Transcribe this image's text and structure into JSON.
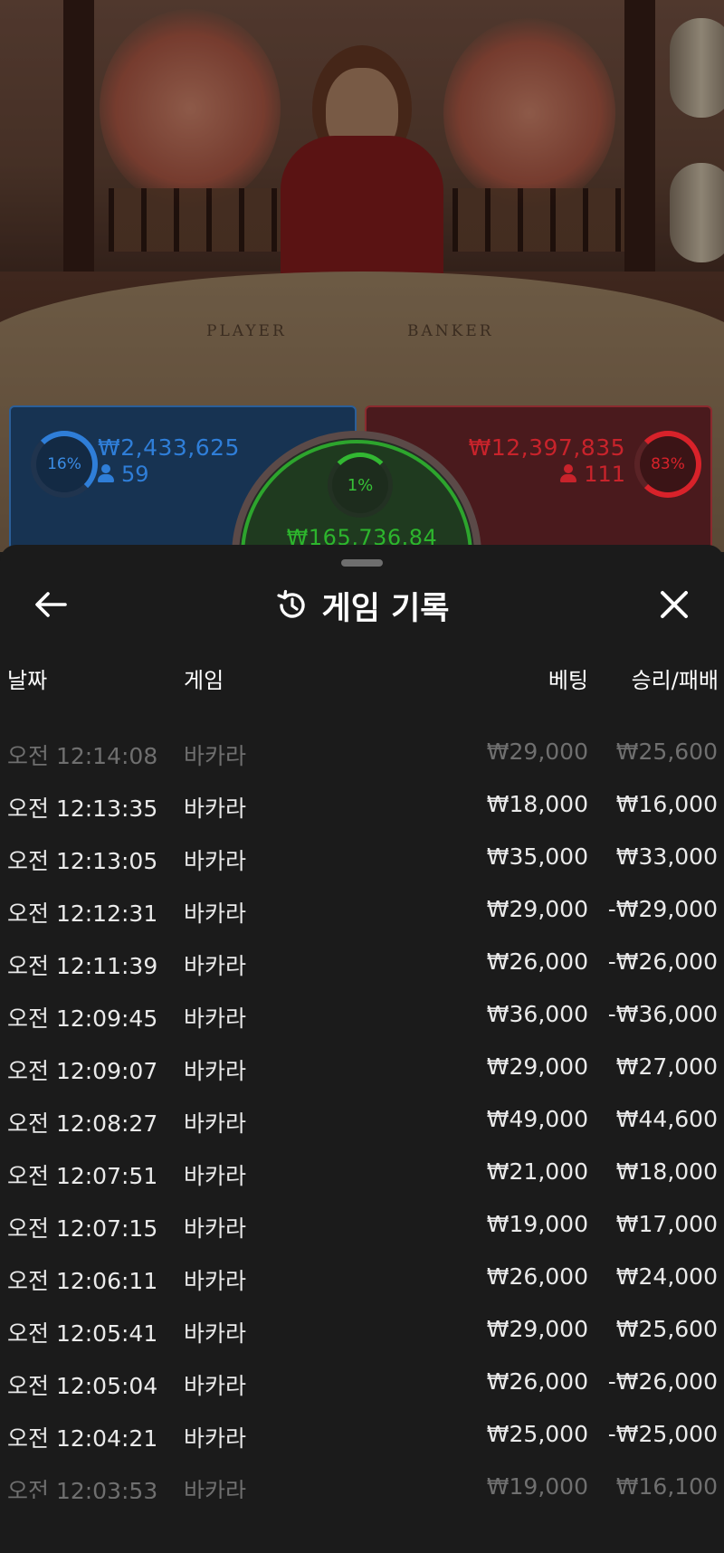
{
  "video": {
    "table_labels": [
      "PLAYER",
      "BANKER"
    ]
  },
  "bets": {
    "player": {
      "percent": "16%",
      "amount": "₩2,433,625",
      "players": "59",
      "color": "#2f7ed8"
    },
    "tie": {
      "percent": "1%",
      "amount": "₩165,736.84",
      "color": "#2db52d"
    },
    "banker": {
      "percent": "83%",
      "amount": "₩12,397,835",
      "players": "111",
      "color": "#c8232b"
    }
  },
  "sheet": {
    "title": "게임 기록",
    "icons": {
      "back": "arrow-left-icon",
      "history": "history-clock-icon",
      "close": "close-icon"
    },
    "columns": {
      "date": "날짜",
      "game": "게임",
      "bet": "베팅",
      "result": "승리/패배"
    },
    "rows": [
      {
        "date": "오전 12:14:08",
        "game": "바카라",
        "bet": "₩29,000",
        "result": "₩25,600",
        "dim": true
      },
      {
        "date": "오전 12:13:35",
        "game": "바카라",
        "bet": "₩18,000",
        "result": "₩16,000"
      },
      {
        "date": "오전 12:13:05",
        "game": "바카라",
        "bet": "₩35,000",
        "result": "₩33,000"
      },
      {
        "date": "오전 12:12:31",
        "game": "바카라",
        "bet": "₩29,000",
        "result": "-₩29,000"
      },
      {
        "date": "오전 12:11:39",
        "game": "바카라",
        "bet": "₩26,000",
        "result": "-₩26,000"
      },
      {
        "date": "오전 12:09:45",
        "game": "바카라",
        "bet": "₩36,000",
        "result": "-₩36,000"
      },
      {
        "date": "오전 12:09:07",
        "game": "바카라",
        "bet": "₩29,000",
        "result": "₩27,000"
      },
      {
        "date": "오전 12:08:27",
        "game": "바카라",
        "bet": "₩49,000",
        "result": "₩44,600"
      },
      {
        "date": "오전 12:07:51",
        "game": "바카라",
        "bet": "₩21,000",
        "result": "₩18,000"
      },
      {
        "date": "오전 12:07:15",
        "game": "바카라",
        "bet": "₩19,000",
        "result": "₩17,000"
      },
      {
        "date": "오전 12:06:11",
        "game": "바카라",
        "bet": "₩26,000",
        "result": "₩24,000"
      },
      {
        "date": "오전 12:05:41",
        "game": "바카라",
        "bet": "₩29,000",
        "result": "₩25,600"
      },
      {
        "date": "오전 12:05:04",
        "game": "바카라",
        "bet": "₩26,000",
        "result": "-₩26,000"
      },
      {
        "date": "오전 12:04:21",
        "game": "바카라",
        "bet": "₩25,000",
        "result": "-₩25,000"
      },
      {
        "date": "오전 12:03:53",
        "game": "바카라",
        "bet": "₩19,000",
        "result": "₩16,100",
        "dim": true
      }
    ]
  }
}
